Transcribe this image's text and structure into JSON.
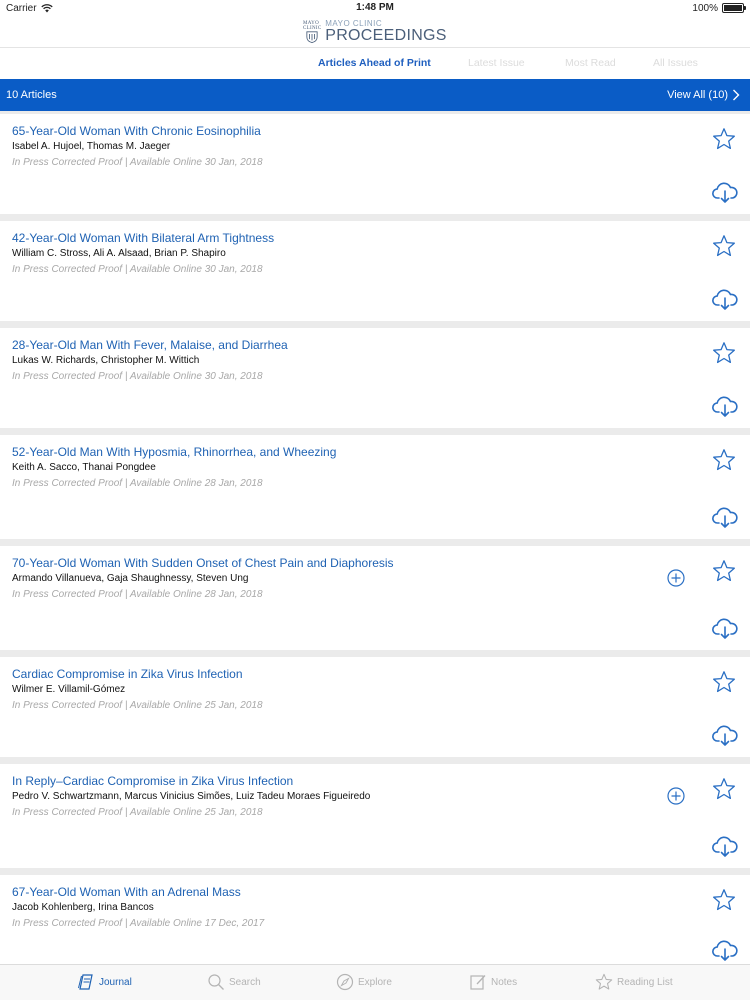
{
  "status": {
    "carrier": "Carrier",
    "time": "1:48 PM",
    "battery": "100%"
  },
  "header": {
    "logo_small": "MAYO CLINIC",
    "logo_shield_text": "MAYO CLINIC",
    "logo_main": "PROCEEDINGS"
  },
  "tabs": [
    {
      "label": "Articles Ahead of Print",
      "active": true
    },
    {
      "label": "Latest Issue",
      "active": false
    },
    {
      "label": "Most Read",
      "active": false
    },
    {
      "label": "All Issues",
      "active": false
    }
  ],
  "list_bar": {
    "count_label": "10 Articles",
    "view_all_label": "View All (10)"
  },
  "articles": [
    {
      "title": "65-Year-Old Woman With Chronic Eosinophilia",
      "authors": "Isabel A. Hujoel, Thomas M. Jaeger",
      "meta": "In Press Corrected Proof | Available Online 30 Jan, 2018",
      "has_plus": false
    },
    {
      "title": "42-Year-Old Woman With Bilateral Arm Tightness",
      "authors": "William C. Stross, Ali A. Alsaad, Brian P. Shapiro",
      "meta": "In Press Corrected Proof | Available Online 30 Jan, 2018",
      "has_plus": false
    },
    {
      "title": "28-Year-Old Man With Fever, Malaise, and Diarrhea",
      "authors": "Lukas W. Richards, Christopher M. Wittich",
      "meta": "In Press Corrected Proof | Available Online 30 Jan, 2018",
      "has_plus": false
    },
    {
      "title": "52-Year-Old Man With Hyposmia, Rhinorrhea, and Wheezing",
      "authors": "Keith A. Sacco, Thanai Pongdee",
      "meta": "In Press Corrected Proof | Available Online 28 Jan, 2018",
      "has_plus": false
    },
    {
      "title": "70-Year-Old Woman With Sudden Onset of Chest Pain and Diaphoresis",
      "authors": "Armando Villanueva, Gaja Shaughnessy, Steven Ung",
      "meta": "In Press Corrected Proof | Available Online 28 Jan, 2018",
      "has_plus": true
    },
    {
      "title": "Cardiac Compromise in Zika Virus Infection",
      "authors": "Wilmer E. Villamil-Gómez",
      "meta": "In Press Corrected Proof | Available Online 25 Jan, 2018",
      "has_plus": false
    },
    {
      "title": "In Reply–Cardiac Compromise in Zika Virus Infection",
      "authors": "Pedro V. Schwartzmann, Marcus Vinicius Simões, Luiz Tadeu Moraes Figueiredo",
      "meta": "In Press Corrected Proof | Available Online 25 Jan, 2018",
      "has_plus": true
    },
    {
      "title": "67-Year-Old Woman With an Adrenal Mass",
      "authors": "Jacob Kohlenberg, Irina Bancos",
      "meta": "In Press Corrected Proof | Available Online 17 Dec, 2017",
      "has_plus": false
    }
  ],
  "tabbar": [
    {
      "label": "Journal",
      "icon": "journal-icon",
      "active": true
    },
    {
      "label": "Search",
      "icon": "search-icon",
      "active": false
    },
    {
      "label": "Explore",
      "icon": "compass-icon",
      "active": false
    },
    {
      "label": "Notes",
      "icon": "notes-icon",
      "active": false
    },
    {
      "label": "Reading List",
      "icon": "star-icon",
      "active": false
    }
  ],
  "colors": {
    "accent": "#0a5cc6",
    "link": "#1f62b3",
    "icon": "#2a6fc4"
  }
}
